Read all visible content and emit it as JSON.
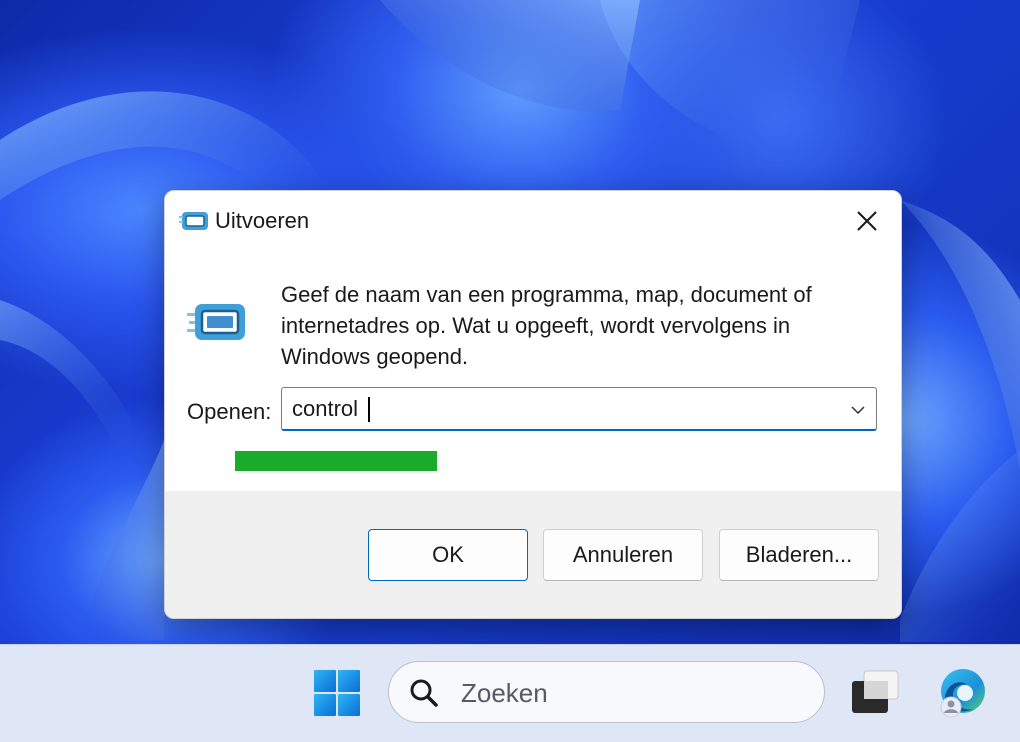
{
  "dialog": {
    "title": "Uitvoeren",
    "description": "Geef de naam van een programma, map, document of internetadres op. Wat u opgeeft, wordt vervolgens in Windows geopend.",
    "open_label": "Openen:",
    "open_value": "control",
    "buttons": {
      "ok": "OK",
      "cancel": "Annuleren",
      "browse": "Bladeren..."
    },
    "icons": {
      "title": "run-icon",
      "main": "run-icon",
      "close": "close-icon",
      "dropdown": "chevron-down-icon"
    },
    "highlight_color": "#1aab2a"
  },
  "taskbar": {
    "search_placeholder": "Zoeken",
    "icons": {
      "start": "windows-logo-icon",
      "search": "search-icon",
      "task_view": "task-view-icon",
      "edge": "edge-icon"
    }
  },
  "colors": {
    "accent": "#0067c0",
    "wallpaper": "#1b3fd6"
  }
}
